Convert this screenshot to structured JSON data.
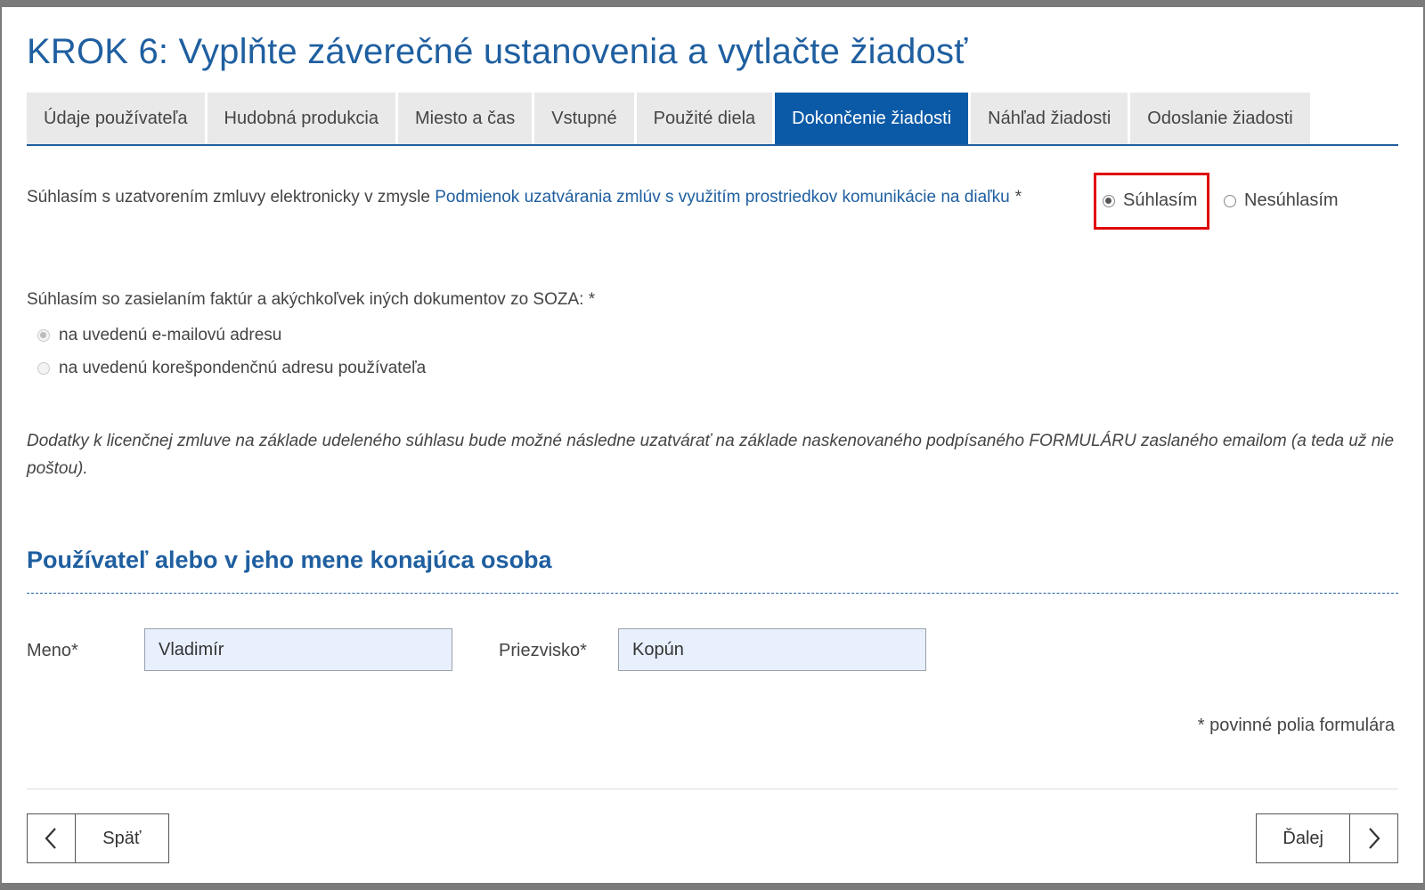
{
  "page": {
    "title": "KROK 6: Vyplňte záverečné ustanovenia a vytlačte žiadosť"
  },
  "tabs": [
    {
      "label": "Údaje používateľa",
      "active": false
    },
    {
      "label": "Hudobná produkcia",
      "active": false
    },
    {
      "label": "Miesto a čas",
      "active": false
    },
    {
      "label": "Vstupné",
      "active": false
    },
    {
      "label": "Použité diela",
      "active": false
    },
    {
      "label": "Dokončenie žiadosti",
      "active": true
    },
    {
      "label": "Náhľad žiadosti",
      "active": false
    },
    {
      "label": "Odoslanie žiadosti",
      "active": false
    }
  ],
  "consent": {
    "text_before": "Súhlasím s uzatvorením zmluvy elektronicky v zmysle ",
    "link_text": "Podmienok uzatvárania zmlúv s využitím prostriedkov komunikácie na diaľku",
    "required_mark": "*",
    "options": {
      "agree": "Súhlasím",
      "disagree": "Nesúhlasím"
    },
    "selected": "agree",
    "highlight_color": "#e00000"
  },
  "documents": {
    "label": "Súhlasím so zasielaním faktúr a akýchkoľvek iných dokumentov zo SOZA:",
    "required_mark": "*",
    "options": {
      "email": "na uvedenú e-mailovú adresu",
      "postal": "na uvedenú korešpondenčnú adresu používateľa"
    },
    "selected": "email",
    "disabled": true
  },
  "note": "Dodatky k licenčnej zmluve na základe udeleného súhlasu bude možné následne uzatvárať na základe naskenovaného podpísaného FORMULÁRU zaslaného emailom (a teda už nie poštou).",
  "person": {
    "section_title": "Používateľ alebo v jeho mene konajúca osoba",
    "first_name_label": "Meno*",
    "first_name_value": "Vladimír",
    "last_name_label": "Priezvisko*",
    "last_name_value": "Kopún"
  },
  "required_note": "* povinné polia formulára",
  "nav": {
    "back_label": "Späť",
    "next_label": "Ďalej"
  },
  "colors": {
    "accent": "#1f5fa0",
    "active_tab": "#0b5aa7",
    "input_bg": "#e8f0fe"
  }
}
